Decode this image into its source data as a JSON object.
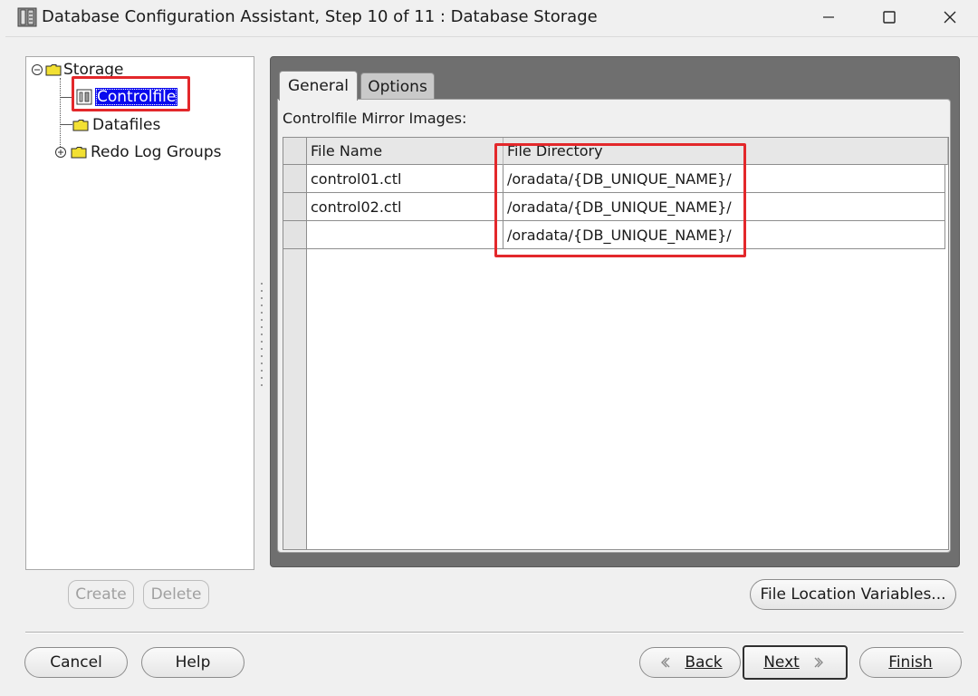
{
  "window": {
    "title": "Database Configuration Assistant, Step 10 of 11 : Database Storage"
  },
  "tree": {
    "root": "Storage",
    "items": [
      {
        "label": "Controlfile",
        "selected": true
      },
      {
        "label": "Datafiles"
      },
      {
        "label": "Redo Log Groups",
        "expandable": true
      }
    ]
  },
  "left_buttons": {
    "create": "Create",
    "delete": "Delete"
  },
  "tabs": [
    {
      "label": "General",
      "active": true
    },
    {
      "label": "Options"
    }
  ],
  "general": {
    "section_label": "Controlfile Mirror Images:",
    "table": {
      "headers": [
        "File Name",
        "File Directory"
      ],
      "rows": [
        {
          "file_name": "control01.ctl",
          "file_directory": "/oradata/{DB_UNIQUE_NAME}/"
        },
        {
          "file_name": "control02.ctl",
          "file_directory": "/oradata/{DB_UNIQUE_NAME}/"
        },
        {
          "file_name": "",
          "file_directory": "/oradata/{DB_UNIQUE_NAME}/"
        }
      ]
    }
  },
  "file_location_button": "File Location Variables...",
  "footer": {
    "cancel": "Cancel",
    "help": "Help",
    "back": "Back",
    "next": "Next",
    "finish": "Finish"
  },
  "colors": {
    "selection": "#0a0aee",
    "highlight_box": "#e3282b",
    "panel_dark": "#6f6f6f"
  }
}
